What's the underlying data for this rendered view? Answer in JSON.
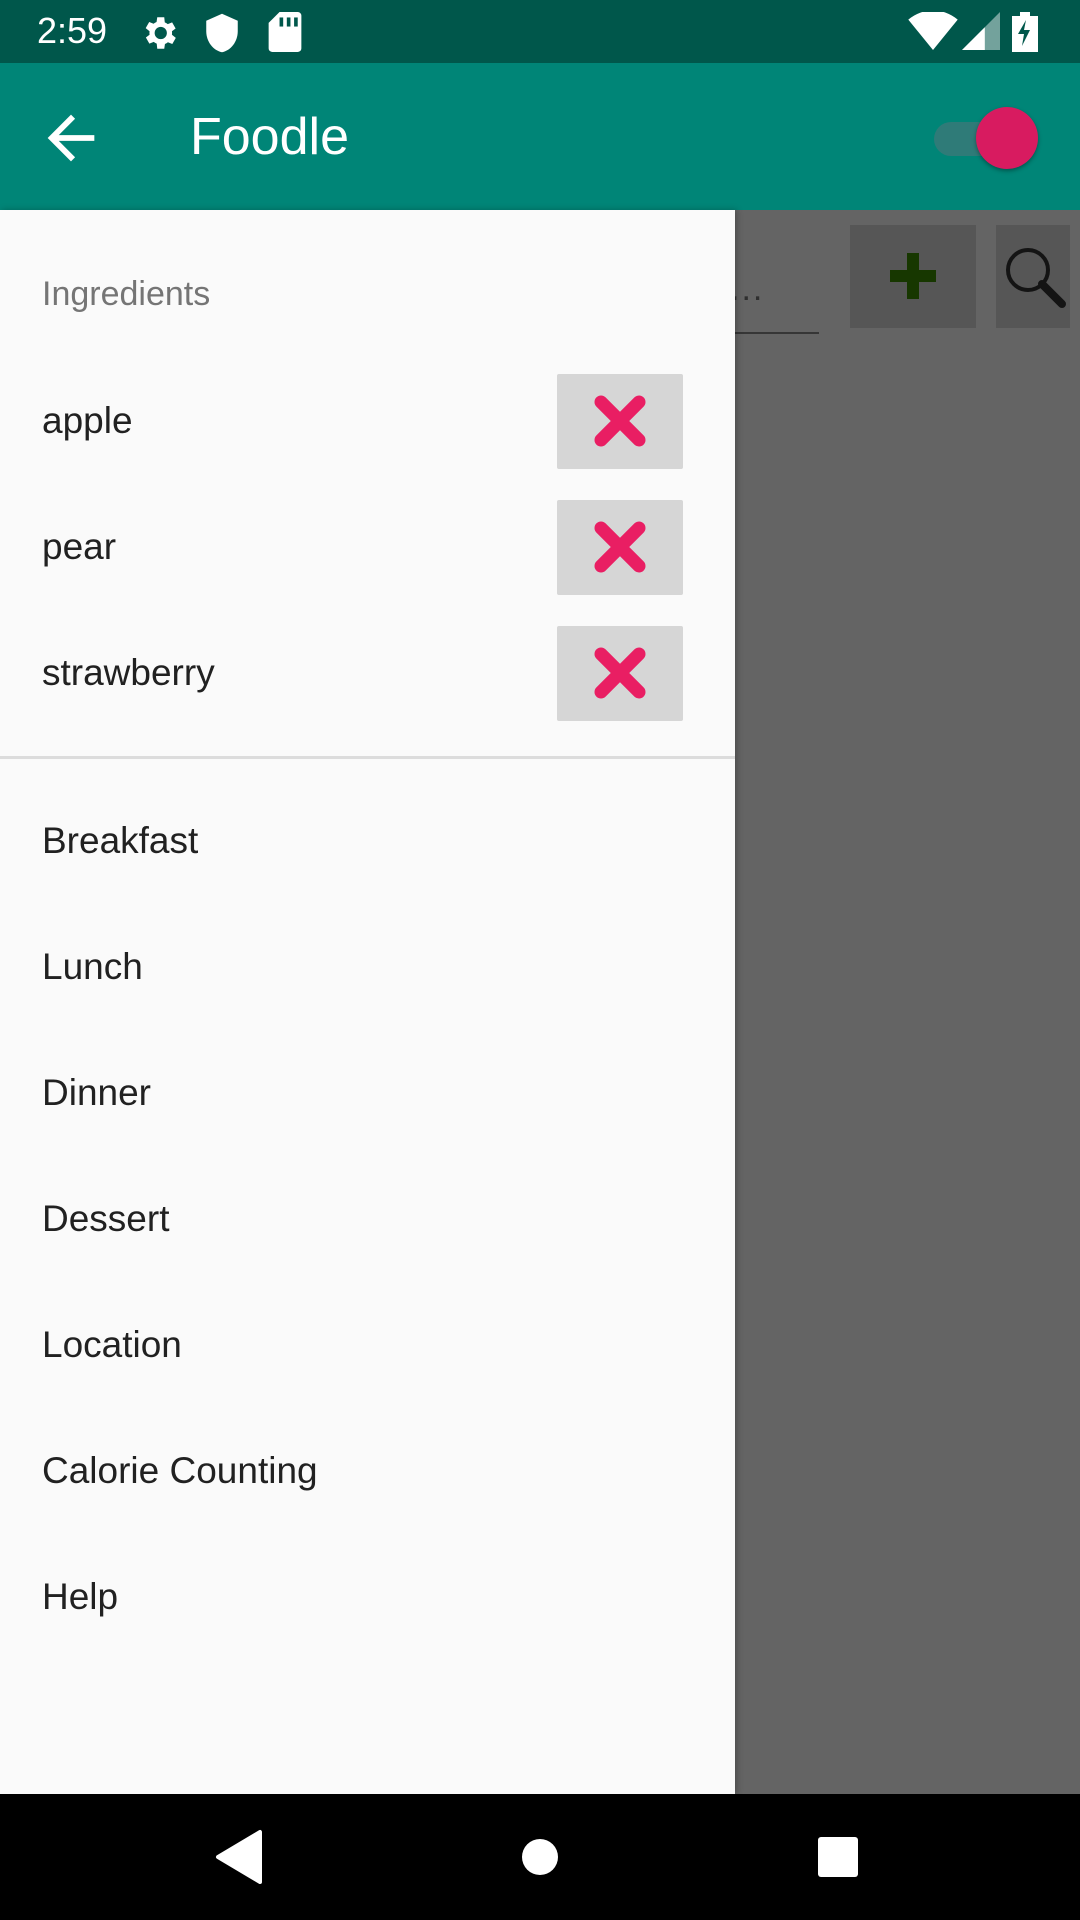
{
  "status_bar": {
    "time": "2:59",
    "icons": [
      "gear-icon",
      "shield-icon",
      "sd-card-icon",
      "wifi-icon",
      "cellular-signal-icon",
      "battery-charging-icon"
    ]
  },
  "app_bar": {
    "title": "Foodle",
    "back_icon": "arrow-left-icon",
    "toggle_on": true,
    "colors": {
      "primary": "#008577",
      "primary_dark": "#00574b",
      "accent": "#d81b60"
    }
  },
  "main": {
    "search_placeholder": "...",
    "add_icon": "plus-icon",
    "search_icon": "magnifier-icon"
  },
  "drawer": {
    "section_title": "Ingredients",
    "ingredients": [
      {
        "label": "apple",
        "remove_icon": "close-icon"
      },
      {
        "label": "pear",
        "remove_icon": "close-icon"
      },
      {
        "label": "strawberry",
        "remove_icon": "close-icon"
      }
    ],
    "menu_items": [
      {
        "label": "Breakfast"
      },
      {
        "label": "Lunch"
      },
      {
        "label": "Dinner"
      },
      {
        "label": "Dessert"
      },
      {
        "label": "Location"
      },
      {
        "label": "Calorie Counting"
      },
      {
        "label": "Help"
      }
    ]
  },
  "nav_bar": {
    "buttons": [
      "back-triangle-icon",
      "home-circle-icon",
      "recents-square-icon"
    ]
  }
}
